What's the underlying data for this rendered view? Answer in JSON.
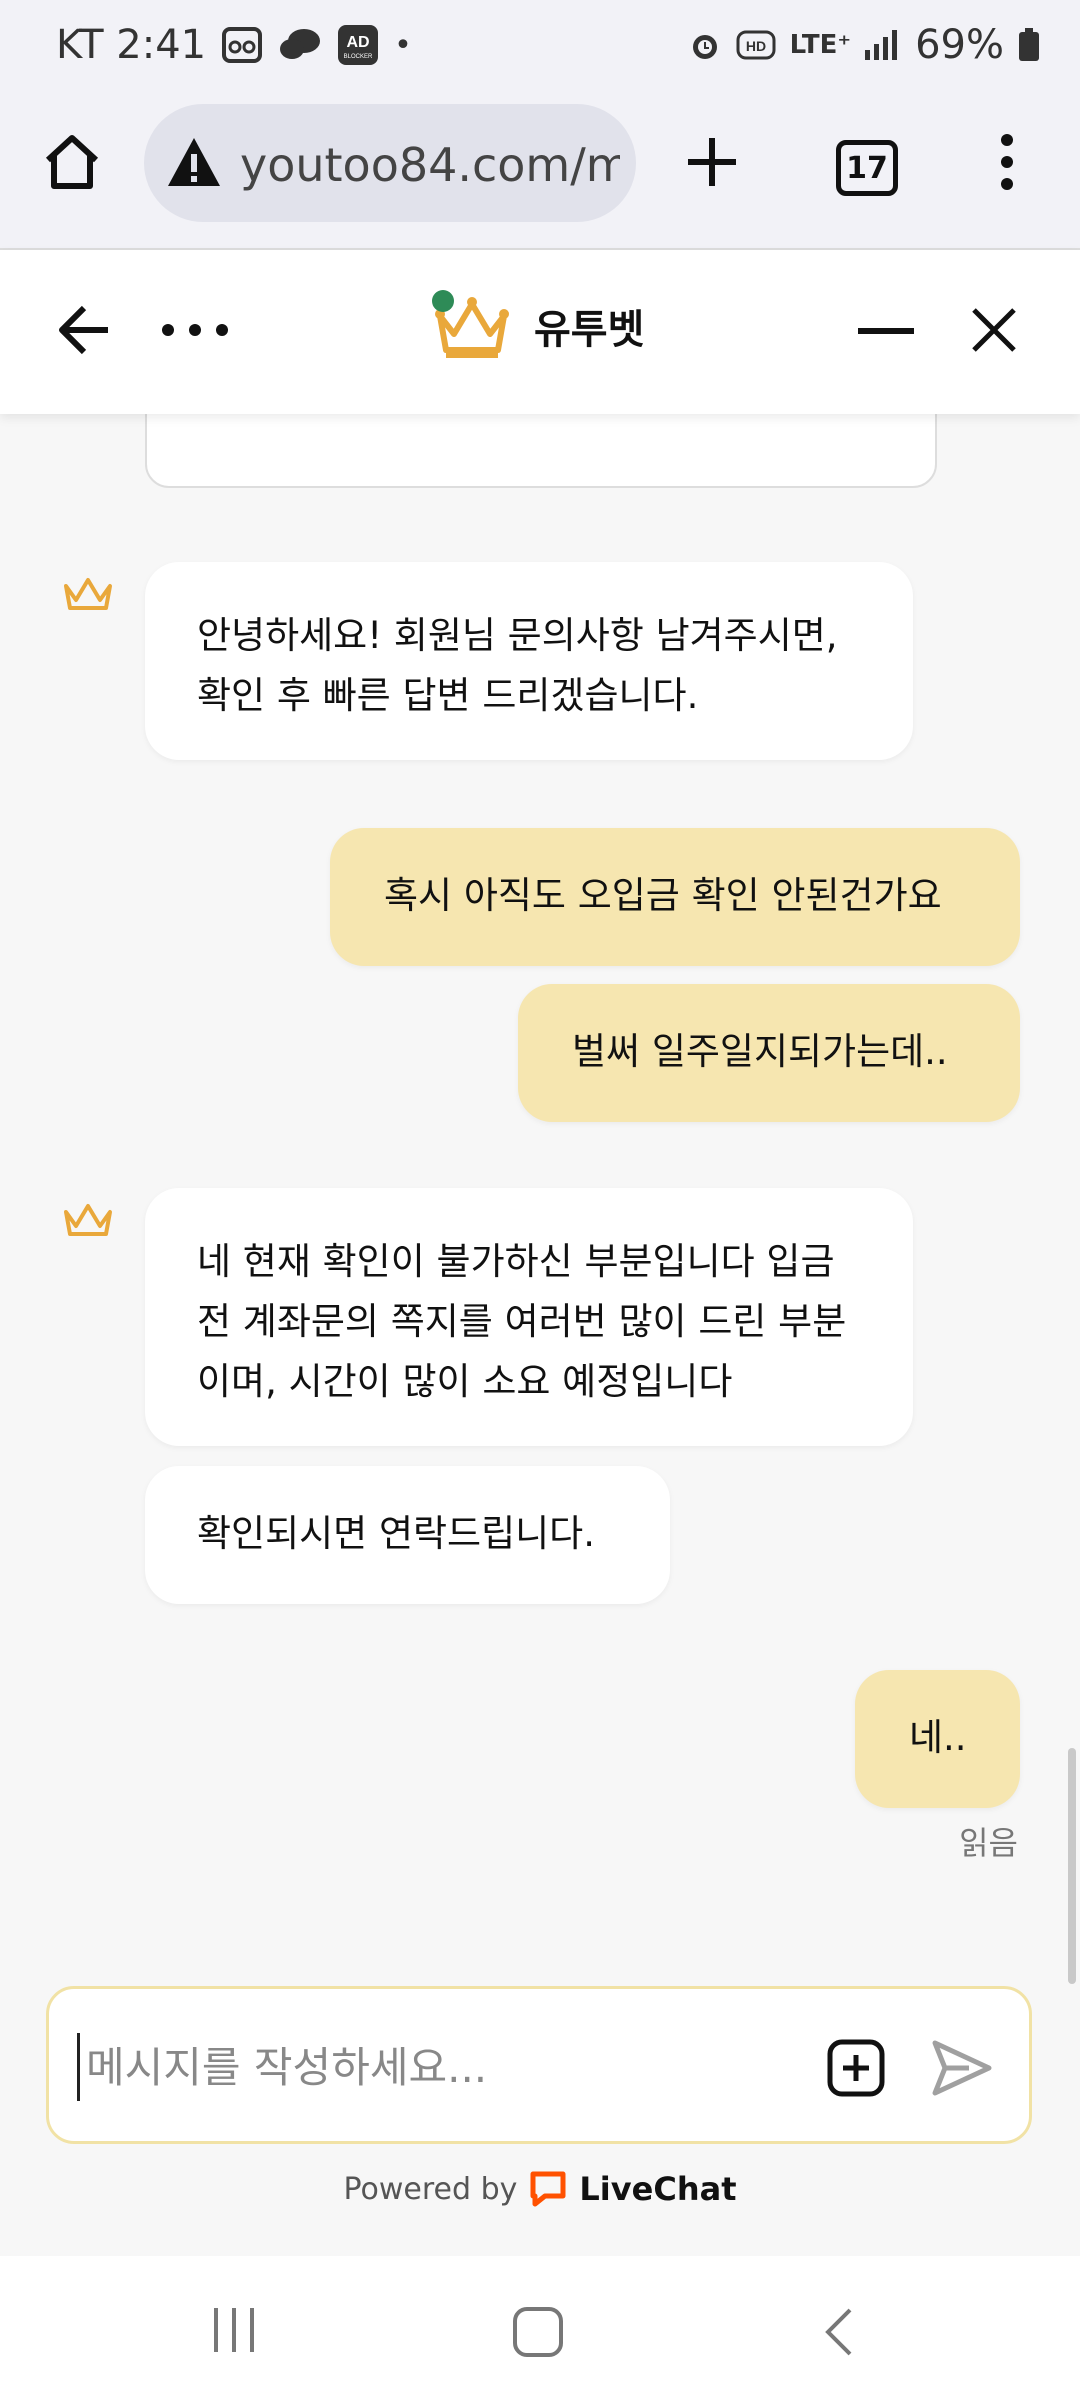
{
  "status_bar": {
    "carrier_time": "KT 2:41",
    "ad_badge": "AD",
    "ad_badge_sub": "BLOCKER",
    "network": "LTE⁺",
    "hd": "HD",
    "battery": "69%"
  },
  "browser": {
    "url": "youtoo84.com/me",
    "tab_count": "17"
  },
  "chat_header": {
    "brand_name": "유투벳",
    "online_color": "#2e8b57"
  },
  "messages": {
    "agent1": "안녕하세요! 회원님 문의사항 남겨주시면, 확인 후 빠른 답변 드리겠습니다.",
    "user1": "혹시 아직도 오입금 확인 안된건가요",
    "user2": "벌써 일주일지되가는데..",
    "agent2": "네 현재 확인이 불가하신 부분입니다 입금전 계좌문의 쪽지를 여러번 많이 드린 부분이며, 시간이 많이 소요 예정입니다",
    "agent3": "확인되시면 연락드립니다.",
    "user3": "네..",
    "read_status": "읽음"
  },
  "composer": {
    "placeholder": "메시지를 작성하세요...",
    "value": ""
  },
  "footer": {
    "powered_by": "Powered by",
    "brand": "LiveChat"
  },
  "colors": {
    "user_bubble": "#f6e6b0",
    "agent_bubble": "#ffffff",
    "crown": "#e9a83b",
    "livechat": "#ff5100"
  },
  "icons": [
    "home-icon",
    "warning-icon",
    "plus-icon",
    "tabs-icon",
    "more-vert-icon",
    "back-arrow-icon",
    "more-horiz-icon",
    "crown-icon",
    "minimize-icon",
    "close-icon",
    "attach-icon",
    "send-icon",
    "livechat-icon",
    "recents-icon",
    "nav-home-icon",
    "nav-back-icon"
  ]
}
